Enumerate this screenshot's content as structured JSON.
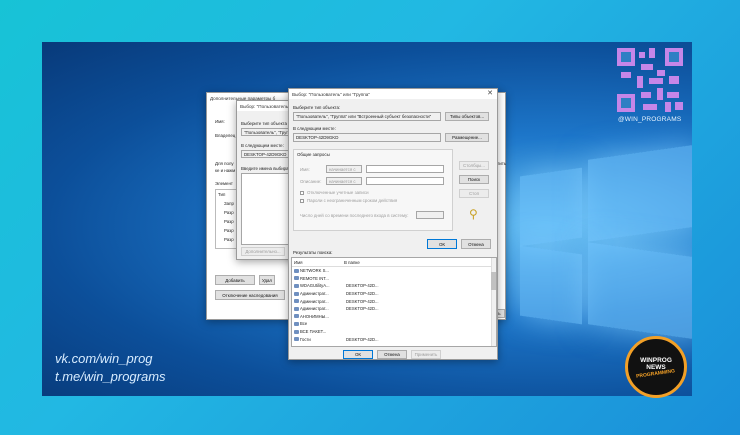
{
  "watermark": {
    "handle": "@WIN_PROGRAMS",
    "vk": "vk.com/win_prog",
    "tg": "t.me/win_programs",
    "badge": {
      "line1": "WINPROG",
      "line2": "NEWS",
      "line3": "PROGRAMMING"
    }
  },
  "bg_window": {
    "title": "Дополнительные параметры б",
    "name_label": "Имя:",
    "owner_label": "Владелец",
    "perm_text_1": "Для полу",
    "perm_text_2": "ке и нажм",
    "elements_label": "Элемент",
    "type_col": "Тип",
    "rows": [
      "Запр",
      "Разр",
      "Разр",
      "Разр",
      "Разр"
    ],
    "add_button": "Добавить",
    "remove_button": "Удал",
    "disable_inheritance": "Отключение наследования",
    "right_text": "пить",
    "right_text2": "ить",
    "apply_button": "нить"
  },
  "mid_window": {
    "title": "Выбор: \"Пользователь\" или",
    "select_type_label": "Выберите тип объекта",
    "object_type_value": "\"Пользователь\", \"Груп",
    "location_label": "В следующем месте:",
    "location_value": "DESKTOP-42D9GKD",
    "names_label": "Введите имена выбира",
    "advanced_button": "Дополнительно..."
  },
  "main_window": {
    "title": "Выбор: \"Пользователь\" или \"Группа\"",
    "select_type_label": "Выберите тип объекта:",
    "object_type_value": "\"Пользователь\", \"Группа\" или \"Встроенный субъект безопасности\"",
    "object_types_button": "Типы объектов...",
    "location_label": "В следующем месте:",
    "location_value": "DESKTOP-42D9GKD",
    "locations_button": "Размещение...",
    "common_queries_tab": "Общие запросы",
    "name_label": "Имя:",
    "name_mode": "начинается с",
    "description_label": "Описание:",
    "description_mode": "начинается с",
    "disabled_accounts": "Отключенные учетные записи",
    "no_expire_password": "Пароли с неограниченным сроком действия",
    "days_since_logon": "Число дней со времени последнего входа в систему:",
    "columns_button": "Столбцы...",
    "search_button": "Поиск",
    "stop_button": "Стоп",
    "ok_button": "ОК",
    "cancel_button": "Отмена",
    "results_label": "Результаты поиска:",
    "col_name": "Имя",
    "col_folder": "В папке",
    "results": [
      {
        "name": "NETWORK S...",
        "folder": ""
      },
      {
        "name": "REMOTE INT...",
        "folder": ""
      },
      {
        "name": "WDAGUtilityA...",
        "folder": "DESKTOP-42D..."
      },
      {
        "name": "Администрат...",
        "folder": "DESKTOP-42D..."
      },
      {
        "name": "Администрат...",
        "folder": "DESKTOP-42D..."
      },
      {
        "name": "Администрат...",
        "folder": "DESKTOP-42D..."
      },
      {
        "name": "АНОНИМНЫ...",
        "folder": ""
      },
      {
        "name": "Все",
        "folder": ""
      },
      {
        "name": "ВСЕ ПАКЕТ...",
        "folder": ""
      },
      {
        "name": "Гости",
        "folder": "DESKTOP-42D..."
      }
    ],
    "bottom_ok": "ОК",
    "bottom_cancel": "Отмена",
    "bottom_apply": "Применить"
  },
  "colors": {
    "accent": "#0078d7",
    "badge_ring": "#f2a027"
  },
  "icons": [
    "close-icon",
    "user-icon",
    "group-icon",
    "search-people-icon",
    "windows-logo"
  ]
}
